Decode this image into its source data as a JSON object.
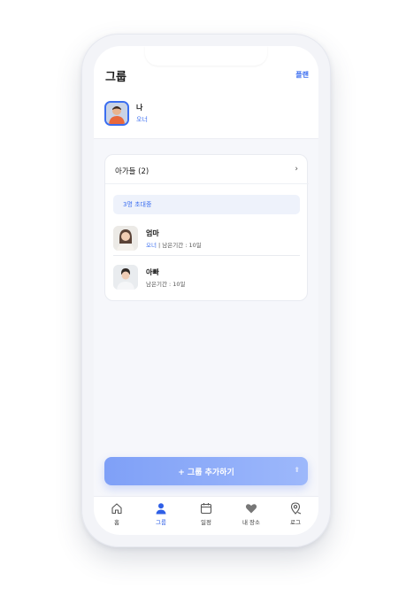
{
  "header": {
    "title": "그룹",
    "plan_label": "플랜"
  },
  "me": {
    "name": "나",
    "role": "오너"
  },
  "group": {
    "title": "아가들 (2)",
    "invite_text": "3명 초대중",
    "members": [
      {
        "name": "엄마",
        "role": "오너",
        "separator": " | ",
        "remaining": "남은기간 : 10일"
      },
      {
        "name": "아빠",
        "remaining": "남은기간 : 10일"
      }
    ]
  },
  "add_button": {
    "label": "+ 그룹 추가하기"
  },
  "tabs": [
    {
      "label": "홈",
      "icon": "home-icon"
    },
    {
      "label": "그룹",
      "icon": "person-icon",
      "active": true
    },
    {
      "label": "일정",
      "icon": "calendar-icon"
    },
    {
      "label": "내 장소",
      "icon": "heart-icon"
    },
    {
      "label": "로그",
      "icon": "location-pin-icon"
    }
  ],
  "colors": {
    "accent": "#3b6ef0",
    "button_gradient_start": "#7fa0f7",
    "button_gradient_end": "#9db8fb"
  }
}
